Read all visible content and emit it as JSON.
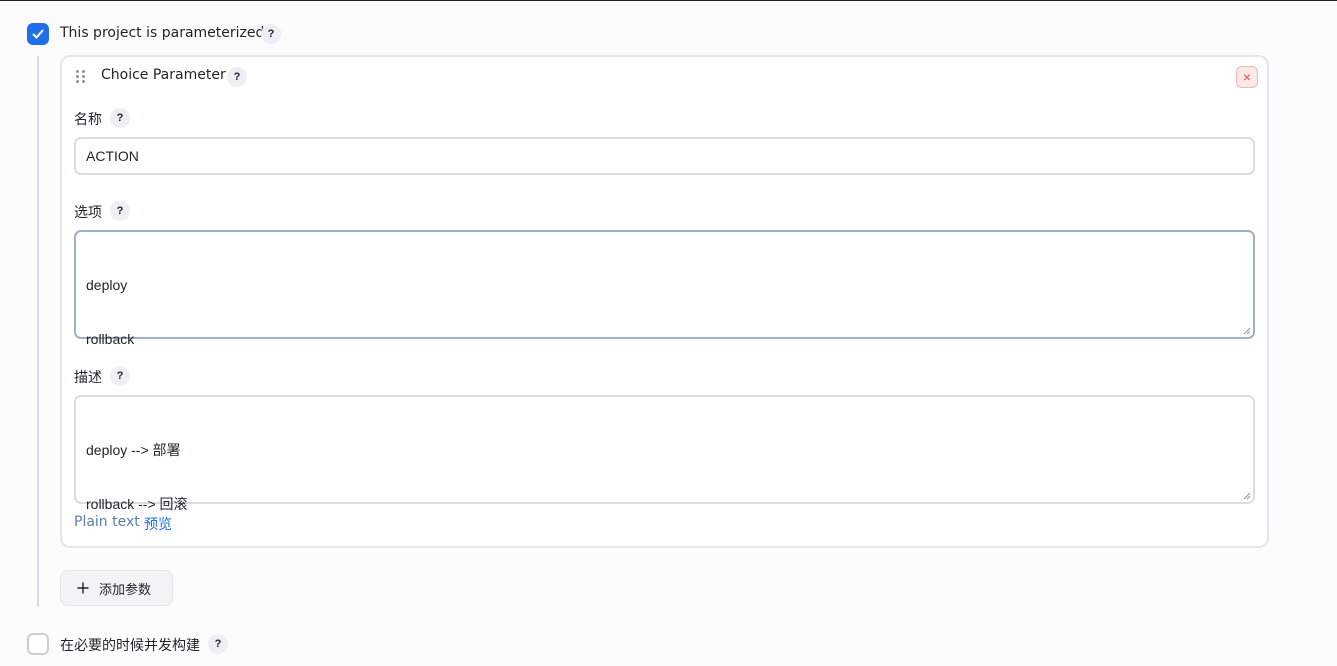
{
  "parameterized": {
    "checked": true,
    "label": "This project is parameterized",
    "help": "?"
  },
  "parameter_card": {
    "title": "Choice Parameter",
    "help": "?",
    "close_symbol": "×",
    "name_field": {
      "label": "名称",
      "help": "?",
      "value": "ACTION"
    },
    "choices_field": {
      "label": "选项",
      "help": "?",
      "lines": [
        "deploy",
        "rollback"
      ]
    },
    "description_field": {
      "label": "描述",
      "help": "?",
      "lines": [
        "deploy --> 部署",
        "rollback --> 回滚"
      ]
    },
    "format_links": {
      "plain": "Plain text",
      "preview": "预览"
    }
  },
  "add_parameter_button": {
    "label": "添加参数",
    "icon": "plus-icon"
  },
  "concurrent_build": {
    "checked": false,
    "label": "在必要的时候并发构建",
    "help": "?"
  },
  "colors": {
    "accent": "#1f6feb",
    "link_muted": "#5b7fa6",
    "link": "#1f6feb",
    "danger": "#e5484d"
  }
}
